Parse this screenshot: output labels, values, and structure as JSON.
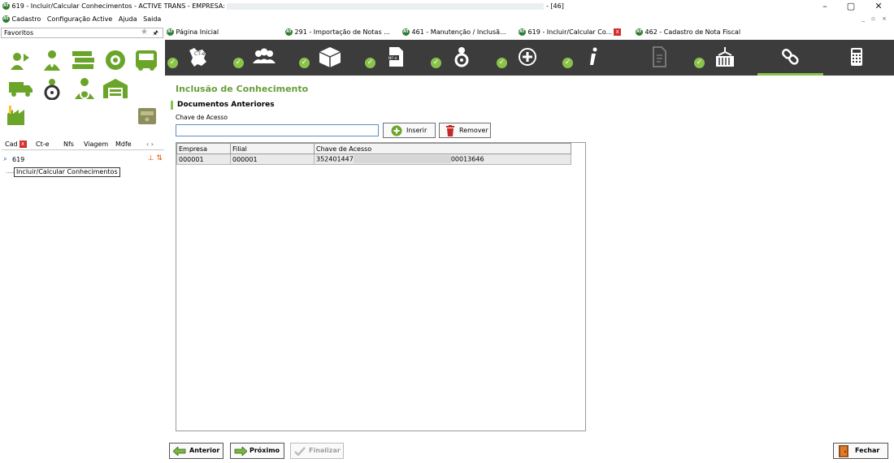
{
  "window": {
    "title_prefix": "619 - Incluir/Calcular Conhecimentos - ACTIVE TRANS - EMPRESA:",
    "title_suffix": "- [46]",
    "controls": {
      "minimize": "–",
      "maximize": "▢",
      "close": "✕"
    }
  },
  "app_logo": "AT",
  "menu": {
    "items": [
      "Cadastro",
      "Configuração Active",
      "Ajuda",
      "Saida"
    ],
    "mdi_controls": "_ ▫ ×"
  },
  "favorites": {
    "label": "Favoritos",
    "star": "★",
    "pin": "🖈"
  },
  "nav_tabs": {
    "items": [
      "Cad",
      "Ct-e",
      "Nfs",
      "Viagem",
      "Mdfe"
    ],
    "close": "x",
    "scroll": "‹ ›"
  },
  "search": {
    "icon": "⌕",
    "value": "619",
    "tools": "⊥ ⇅"
  },
  "tree": {
    "item": "Incluir/Calcular Conhecimentos"
  },
  "doc_tabs": [
    {
      "label": "Página Inicial"
    },
    {
      "label": "291 - Importação de Notas ..."
    },
    {
      "label": "461 - Manutenção / Inclusã..."
    },
    {
      "label": "619 - Incluir/Calcular Co...",
      "close": "x"
    },
    {
      "label": "462 - Cadastro de Nota Fiscal"
    }
  ],
  "steps": [
    {
      "icon": "map-icon",
      "checked": true
    },
    {
      "icon": "people-icon",
      "checked": true
    },
    {
      "icon": "package-icon",
      "checked": true
    },
    {
      "icon": "nfe-document-icon",
      "checked": true
    },
    {
      "icon": "driver-icon",
      "checked": true
    },
    {
      "icon": "plus-icon",
      "checked": true
    },
    {
      "icon": "info-icon",
      "checked": true
    },
    {
      "icon": "document-icon",
      "checked": false
    },
    {
      "icon": "container-icon",
      "checked": true
    },
    {
      "icon": "link-icon",
      "checked": false,
      "active": true
    },
    {
      "icon": "calculator-icon",
      "checked": false
    }
  ],
  "main": {
    "title": "Inclusão de Conhecimento",
    "section": "Documentos Anteriores",
    "key_label": "Chave de Acesso",
    "key_value": "",
    "insert_label": "Inserir",
    "remove_label": "Remover",
    "grid": {
      "columns": [
        "Empresa",
        "Filial",
        "Chave de Acesso"
      ],
      "rows": [
        {
          "empresa": "000001",
          "filial": "000001",
          "chave_start": "352401447",
          "chave_end": "00013646"
        }
      ]
    }
  },
  "footer": {
    "prev_label": "Anterior",
    "next_label": "Próximo",
    "finish_label": "Finalizar",
    "close_label": "Fechar"
  },
  "colors": {
    "accent_green": "#8bc34a",
    "title_green": "#689f38",
    "stepbar_bg": "#3c3c3c",
    "close_red": "#d32f2f",
    "icon_green": "#6aa52a"
  }
}
